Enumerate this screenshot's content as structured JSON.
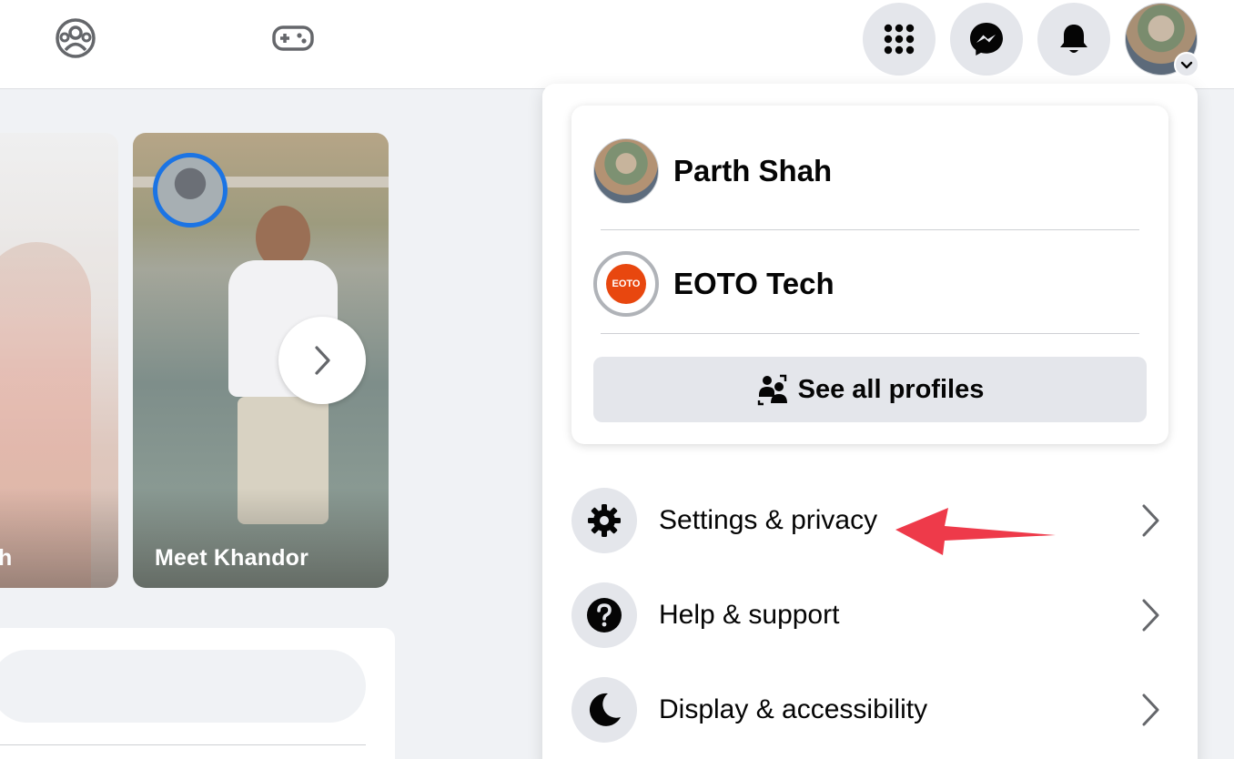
{
  "topbar": {
    "nav_icons": [
      "groups-icon",
      "gaming-icon"
    ],
    "buttons": [
      "menu-grid-icon",
      "messenger-icon",
      "notifications-bell-icon"
    ],
    "account_avatar": "account-avatar"
  },
  "stories": [
    {
      "name": "h",
      "faded": true
    },
    {
      "name": "Meet Khandor",
      "faded": false
    }
  ],
  "menu": {
    "profiles": [
      {
        "name": "Parth Shah",
        "avatar": "profile-photo"
      },
      {
        "name": "EOTO Tech",
        "avatar": "page-logo"
      }
    ],
    "see_all_profiles": "See all profiles",
    "items": [
      {
        "label": "Settings & privacy",
        "icon": "gear-icon"
      },
      {
        "label": "Help & support",
        "icon": "question-icon"
      },
      {
        "label": "Display & accessibility",
        "icon": "moon-icon"
      }
    ]
  },
  "colors": {
    "accent_blue": "#1b74e4",
    "button_gray": "#e4e6eb",
    "annotation_red": "#ee3a4a",
    "eoto_orange": "#e8470f"
  },
  "eoto_logo_text": "EOTO"
}
